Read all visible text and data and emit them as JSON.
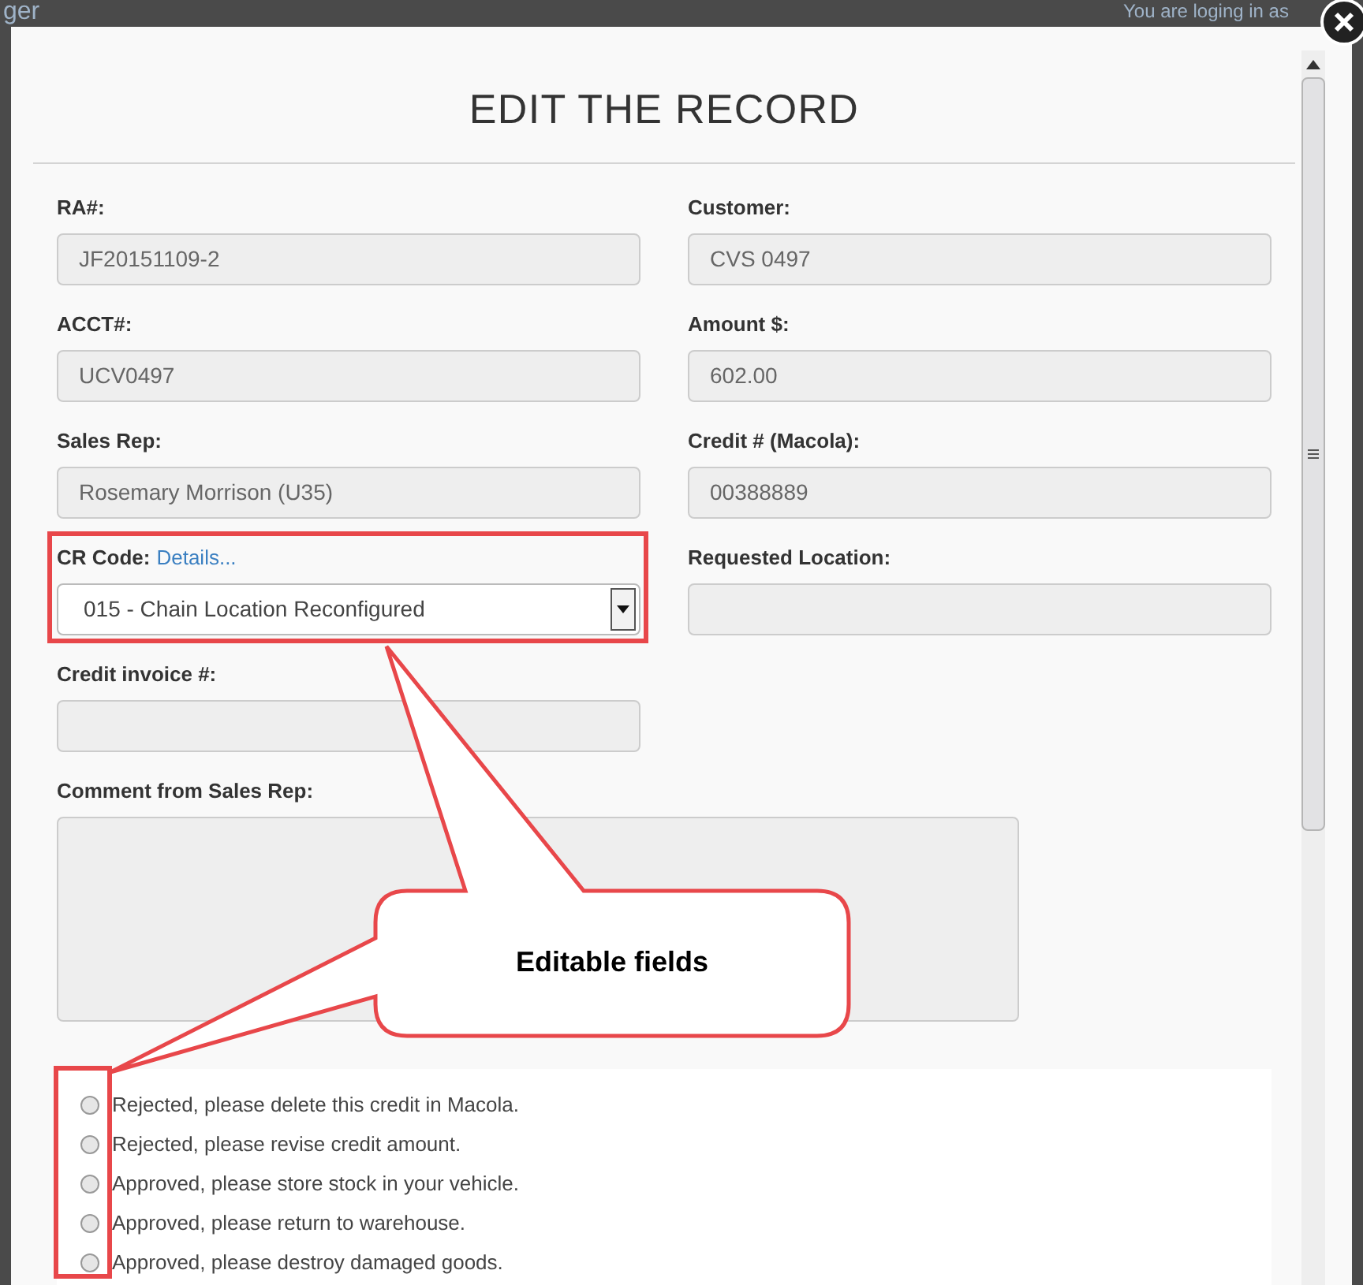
{
  "background": {
    "logo_fragment": "ger",
    "login_notice": "You are loging in as"
  },
  "modal": {
    "title": "EDIT THE RECORD",
    "fields": [
      {
        "kind": "text",
        "label": "RA#:",
        "value": "JF20151109-2"
      },
      {
        "kind": "text",
        "label": "Customer:",
        "value": "CVS 0497"
      },
      {
        "kind": "text",
        "label": "ACCT#:",
        "value": "UCV0497"
      },
      {
        "kind": "text",
        "label": "Amount $:",
        "value": "602.00"
      },
      {
        "kind": "text",
        "label": "Sales Rep:",
        "value": "Rosemary Morrison (U35)"
      },
      {
        "kind": "text",
        "label": "Credit # (Macola):",
        "value": "00388889"
      },
      {
        "kind": "select",
        "label": "CR Code:",
        "link": "Details...",
        "value": "015 - Chain Location Reconfigured"
      },
      {
        "kind": "text",
        "label": "Requested Location:"
      },
      {
        "kind": "text",
        "label": "Credit invoice #:"
      },
      {
        "kind": "textarea",
        "label": "Comment from Sales Rep:"
      }
    ],
    "options": [
      {
        "label": "Rejected, please delete this credit in Macola.",
        "selected": false
      },
      {
        "label": "Rejected, please revise credit amount.",
        "selected": false
      },
      {
        "label": "Approved, please store stock in your vehicle.",
        "selected": false
      },
      {
        "label": "Approved, please return to warehouse.",
        "selected": false
      },
      {
        "label": "Approved, please destroy damaged goods.",
        "selected": false
      }
    ]
  },
  "annotation": {
    "text": "Editable fields"
  }
}
